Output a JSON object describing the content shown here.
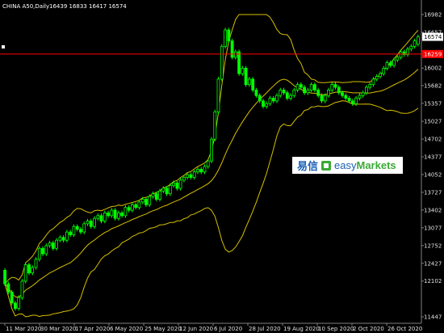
{
  "header": {
    "symbol": "CHINA A50,Daily",
    "ohlc": "16439 16833 16417 16574"
  },
  "price_axis": {
    "labels": [
      "16982",
      "16657",
      "16002",
      "15682",
      "15357",
      "15027",
      "14702",
      "14377",
      "14052",
      "13727",
      "13402",
      "13077",
      "12752",
      "12427",
      "12102",
      "11447"
    ],
    "current_price": "16574",
    "red_line_price": "16259"
  },
  "time_axis": {
    "labels": [
      "11 Mar 2020",
      "30 Mar 2020",
      "17 Apr 2020",
      "6 May 2020",
      "25 May 2020",
      "12 Jun 2020",
      "6 Jul 2020",
      "28 Jul 2020",
      "19 Aug 2020",
      "10 Sep 2020",
      "2 Oct 2020",
      "26 Oct 2020"
    ]
  },
  "watermark": {
    "cn_text": "易信",
    "easy_text": "easy",
    "markets_text": "Markets",
    "logo_icon": "easymarkets-logo-icon"
  },
  "colors": {
    "background": "#000000",
    "bull_candle": "#00ff00",
    "bollinger": "#d8c000",
    "red_line": "#ff0000",
    "axis_text": "#e0e0e0"
  },
  "chart_data": {
    "type": "candlestick",
    "title": "CHINA A50,Daily",
    "indicator": "Bollinger Bands",
    "ylim": [
      11447,
      16982
    ],
    "xlabel": "",
    "ylabel": "",
    "close": [
      12050,
      11900,
      11700,
      11600,
      11800,
      12100,
      12400,
      12250,
      12350,
      12500,
      12700,
      12600,
      12750,
      12800,
      12700,
      12850,
      12900,
      12850,
      13000,
      12950,
      13100,
      13050,
      13000,
      13150,
      13200,
      13100,
      13250,
      13300,
      13200,
      13350,
      13300,
      13400,
      13250,
      13350,
      13300,
      13450,
      13400,
      13500,
      13450,
      13550,
      13600,
      13500,
      13650,
      13700,
      13600,
      13750,
      13800,
      13700,
      13850,
      13900,
      13800,
      13950,
      14000,
      14050,
      14000,
      14100,
      14150,
      14100,
      14200,
      14300,
      14700,
      15200,
      15800,
      16400,
      16700,
      16500,
      16200,
      16300,
      15900,
      16000,
      15700,
      15800,
      15600,
      15500,
      15400,
      15300,
      15350,
      15450,
      15400,
      15500,
      15600,
      15550,
      15450,
      15500,
      15600,
      15700,
      15650,
      15550,
      15600,
      15700,
      15600,
      15500,
      15400,
      15500,
      15600,
      15700,
      15650,
      15550,
      15500,
      15450,
      15400,
      15350,
      15450,
      15500,
      15550,
      15650,
      15700,
      15800,
      15850,
      15900,
      16000,
      16100,
      16050,
      16150,
      16200,
      16300,
      16250,
      16350,
      16400,
      16500,
      16574
    ],
    "open": [
      12300,
      12050,
      11900,
      11700,
      11600,
      11800,
      12100,
      12400,
      12250,
      12350,
      12500,
      12700,
      12600,
      12750,
      12800,
      12700,
      12850,
      12900,
      12850,
      13000,
      12950,
      13100,
      13050,
      13000,
      13150,
      13200,
      13100,
      13250,
      13300,
      13200,
      13350,
      13300,
      13400,
      13250,
      13350,
      13300,
      13450,
      13400,
      13500,
      13450,
      13550,
      13600,
      13500,
      13650,
      13700,
      13600,
      13750,
      13800,
      13700,
      13850,
      13900,
      13800,
      13950,
      14000,
      14050,
      14000,
      14100,
      14150,
      14100,
      14200,
      14300,
      14700,
      15200,
      15800,
      16400,
      16700,
      16500,
      16200,
      16300,
      15900,
      16000,
      15700,
      15800,
      15600,
      15500,
      15400,
      15300,
      15350,
      15450,
      15400,
      15500,
      15600,
      15550,
      15450,
      15500,
      15600,
      15700,
      15650,
      15550,
      15600,
      15700,
      15600,
      15500,
      15400,
      15500,
      15600,
      15700,
      15650,
      15550,
      15500,
      15450,
      15400,
      15350,
      15450,
      15500,
      15550,
      15650,
      15700,
      15800,
      15850,
      15900,
      16000,
      16100,
      16050,
      16150,
      16200,
      16300,
      16250,
      16350,
      16400,
      16439
    ]
  }
}
